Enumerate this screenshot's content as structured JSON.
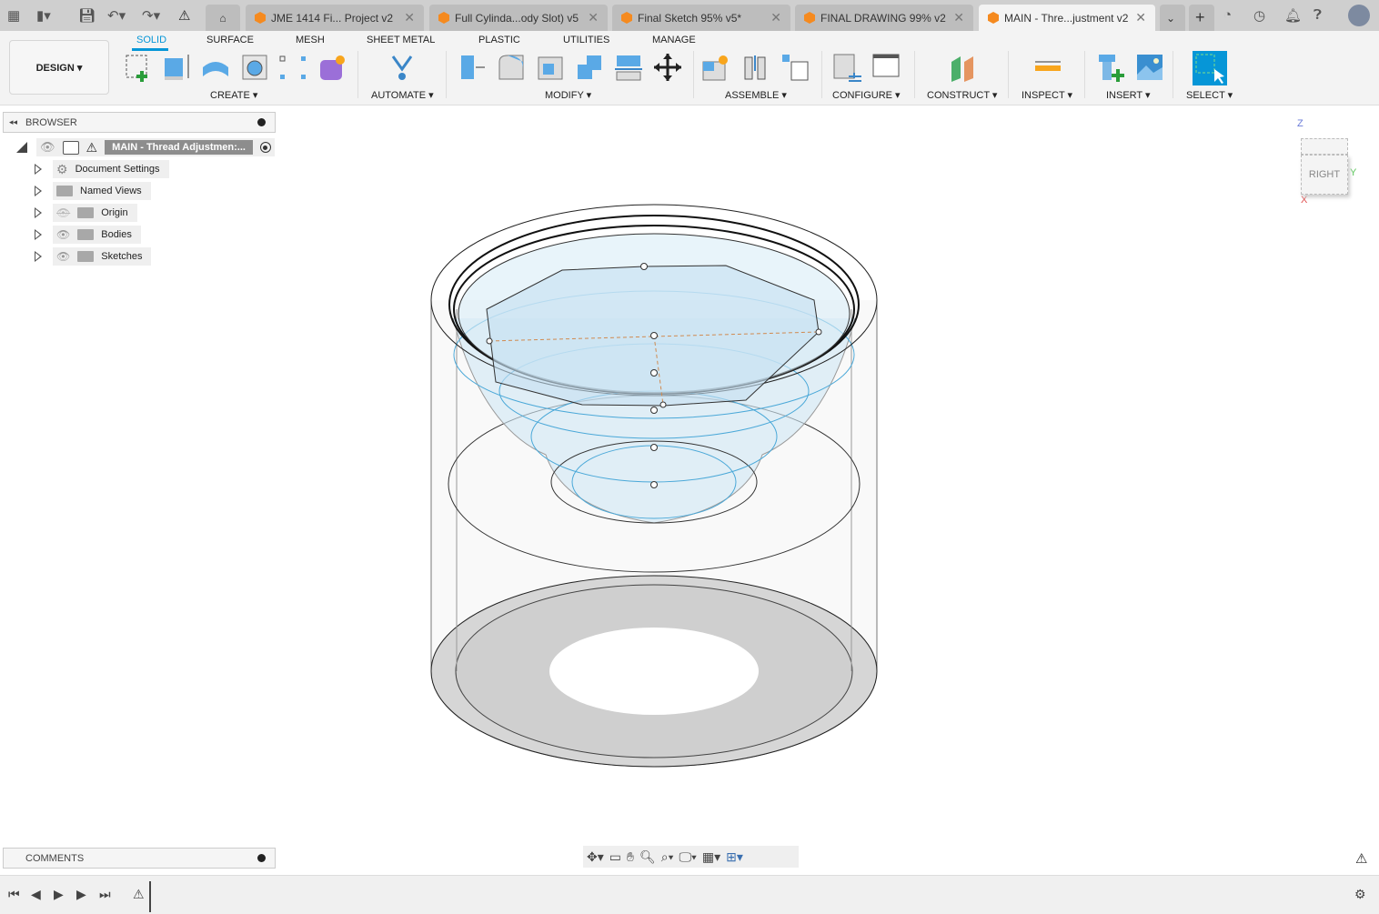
{
  "tabs": [
    {
      "label": "JME 1414 Fi... Project v2"
    },
    {
      "label": "Full Cylinda...ody Slot) v5"
    },
    {
      "label": "Final Sketch 95% v5*"
    },
    {
      "label": "FINAL DRAWING 99% v2"
    },
    {
      "label": "MAIN - Thre...justment v2",
      "active": true
    }
  ],
  "workspace": {
    "label": "DESIGN ▾"
  },
  "ws_tabs": [
    "SOLID",
    "SURFACE",
    "MESH",
    "SHEET METAL",
    "PLASTIC",
    "UTILITIES",
    "MANAGE"
  ],
  "groups": [
    "CREATE ▾",
    "AUTOMATE ▾",
    "MODIFY ▾",
    "ASSEMBLE ▾",
    "CONFIGURE ▾",
    "CONSTRUCT ▾",
    "INSPECT ▾",
    "INSERT ▾",
    "SELECT ▾"
  ],
  "browser": {
    "title": "BROWSER",
    "root": "MAIN - Thread Adjustmen:...",
    "items": [
      "Document Settings",
      "Named Views",
      "Origin",
      "Bodies",
      "Sketches"
    ]
  },
  "comments": {
    "title": "COMMENTS"
  },
  "viewcube": {
    "face": "RIGHT",
    "axes": {
      "z": "Z",
      "y": "Y",
      "x": "X"
    }
  },
  "colors": {
    "accent": "#0696d7",
    "sketch": "#4aa8d8",
    "tab_icon": "#f58a1f"
  }
}
